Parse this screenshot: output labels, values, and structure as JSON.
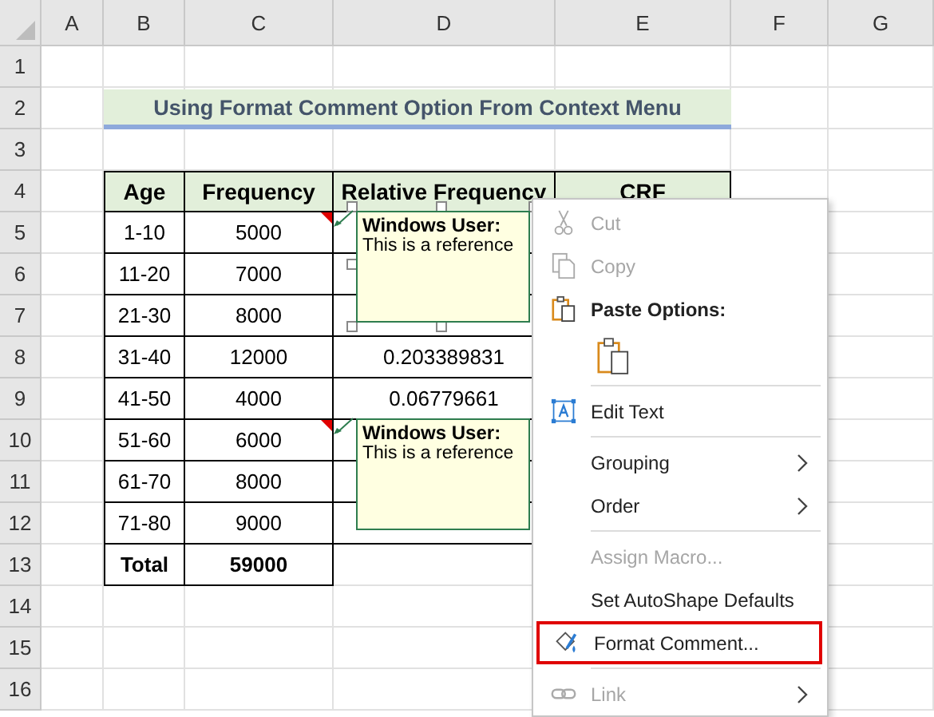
{
  "sheet": {
    "columns": [
      "A",
      "B",
      "C",
      "D",
      "E",
      "F",
      "G"
    ],
    "rows": [
      "1",
      "2",
      "3",
      "4",
      "5",
      "6",
      "7",
      "8",
      "9",
      "10",
      "11",
      "12",
      "13",
      "14",
      "15",
      "16"
    ],
    "title": "Using Format Comment Option From Context Menu",
    "table": {
      "headers": [
        "Age",
        "Frequency",
        "Relative Frequency",
        "CRF"
      ],
      "rows": [
        {
          "age": "1-10",
          "frequency": "5000",
          "has_comment": true
        },
        {
          "age": "11-20",
          "frequency": "7000",
          "has_comment": false
        },
        {
          "age": "21-30",
          "frequency": "8000",
          "has_comment": false
        },
        {
          "age": "31-40",
          "frequency": "12000",
          "has_comment": false,
          "relative_frequency": "0.203389831"
        },
        {
          "age": "41-50",
          "frequency": "4000",
          "has_comment": false,
          "relative_frequency": "0.06779661"
        },
        {
          "age": "51-60",
          "frequency": "6000",
          "has_comment": true
        },
        {
          "age": "61-70",
          "frequency": "8000",
          "has_comment": false
        },
        {
          "age": "71-80",
          "frequency": "9000",
          "has_comment": false
        }
      ],
      "total": {
        "label": "Total",
        "frequency": "59000"
      }
    }
  },
  "comments": [
    {
      "author": "Windows User:",
      "text": "This is a reference",
      "selected": true
    },
    {
      "author": "Windows User:",
      "text": "This is a reference",
      "selected": false
    }
  ],
  "context_menu": {
    "items": [
      {
        "kind": "item",
        "label": "Cut",
        "disabled": true,
        "has_submenu": false,
        "divider_above": false,
        "highlighted": false
      },
      {
        "kind": "item",
        "label": "Copy",
        "disabled": true,
        "has_submenu": false,
        "divider_above": false,
        "highlighted": false
      },
      {
        "kind": "heading",
        "label": "Paste Options:"
      },
      {
        "kind": "paste-button"
      },
      {
        "kind": "item",
        "label": "Edit Text",
        "disabled": false,
        "has_submenu": false,
        "divider_above": true,
        "highlighted": false
      },
      {
        "kind": "item",
        "label": "Grouping",
        "disabled": false,
        "has_submenu": true,
        "divider_above": true,
        "highlighted": false
      },
      {
        "kind": "item",
        "label": "Order",
        "disabled": false,
        "has_submenu": true,
        "divider_above": false,
        "highlighted": false
      },
      {
        "kind": "item",
        "label": "Assign Macro...",
        "disabled": true,
        "has_submenu": false,
        "divider_above": true,
        "highlighted": false
      },
      {
        "kind": "item",
        "label": "Set AutoShape Defaults",
        "disabled": false,
        "has_submenu": false,
        "divider_above": false,
        "highlighted": false
      },
      {
        "kind": "item",
        "label": "Format Comment...",
        "disabled": false,
        "has_submenu": false,
        "divider_above": false,
        "highlighted": true
      },
      {
        "kind": "item",
        "label": "Link",
        "disabled": true,
        "has_submenu": true,
        "divider_above": true,
        "highlighted": false
      }
    ]
  }
}
